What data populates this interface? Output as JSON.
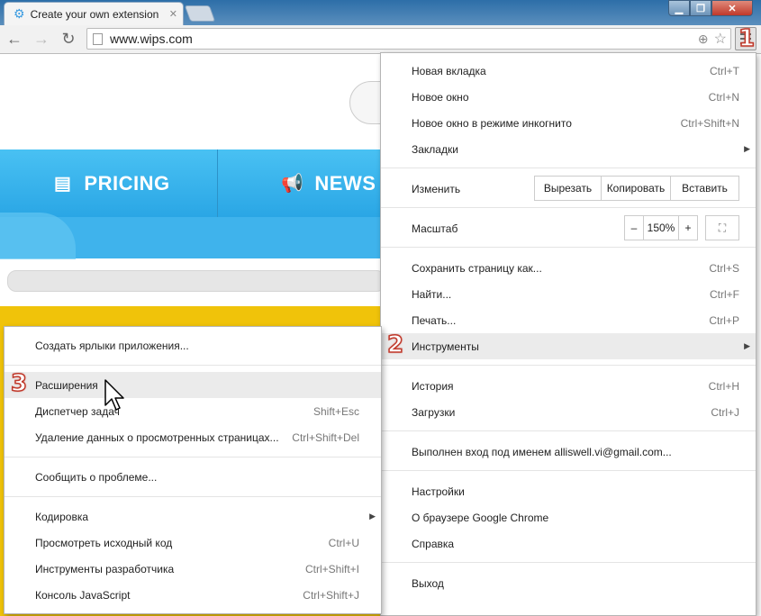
{
  "tab": {
    "title": "Create your own extension"
  },
  "toolbar": {
    "url": "www.wips.com"
  },
  "page": {
    "nav": [
      {
        "label": "PRICING"
      },
      {
        "label": "NEWS"
      }
    ]
  },
  "main_menu": {
    "items": [
      {
        "label": "Новая вкладка",
        "shortcut": "Ctrl+T"
      },
      {
        "label": "Новое окно",
        "shortcut": "Ctrl+N"
      },
      {
        "label": "Новое окно в режиме инкогнито",
        "shortcut": "Ctrl+Shift+N"
      },
      {
        "label": "Закладки"
      }
    ],
    "edit": {
      "label": "Изменить",
      "cut": "Вырезать",
      "copy": "Копировать",
      "paste": "Вставить"
    },
    "zoom": {
      "label": "Масштаб",
      "minus": "–",
      "value": "150%",
      "plus": "+"
    },
    "items2": [
      {
        "label": "Сохранить страницу как...",
        "shortcut": "Ctrl+S"
      },
      {
        "label": "Найти...",
        "shortcut": "Ctrl+F"
      },
      {
        "label": "Печать...",
        "shortcut": "Ctrl+P"
      },
      {
        "label": "Инструменты"
      }
    ],
    "items3": [
      {
        "label": "История",
        "shortcut": "Ctrl+H"
      },
      {
        "label": "Загрузки",
        "shortcut": "Ctrl+J"
      }
    ],
    "signed_in": "Выполнен вход под именем alliswell.vi@gmail.com...",
    "items4": [
      {
        "label": "Настройки"
      },
      {
        "label": "О браузере Google Chrome"
      },
      {
        "label": "Справка"
      }
    ],
    "exit": "Выход"
  },
  "tools_menu": {
    "create_shortcuts": "Создать ярлыки приложения...",
    "items": [
      {
        "label": "Расширения"
      },
      {
        "label": "Диспетчер задач",
        "shortcut": "Shift+Esc"
      },
      {
        "label": "Удаление данных о просмотренных страницах...",
        "shortcut": "Ctrl+Shift+Del"
      }
    ],
    "report": "Сообщить о проблеме...",
    "items2": [
      {
        "label": "Кодировка"
      },
      {
        "label": "Просмотреть исходный код",
        "shortcut": "Ctrl+U"
      },
      {
        "label": "Инструменты разработчика",
        "shortcut": "Ctrl+Shift+I"
      },
      {
        "label": "Консоль JavaScript",
        "shortcut": "Ctrl+Shift+J"
      }
    ]
  },
  "annotations": {
    "step1": "1",
    "step2": "2",
    "step3": "3"
  },
  "colors": {
    "accent_blue": "#3fb3ec",
    "yellow": "#f0c30a",
    "menu_highlight": "#ebebeb",
    "badge": "#c0392b"
  }
}
